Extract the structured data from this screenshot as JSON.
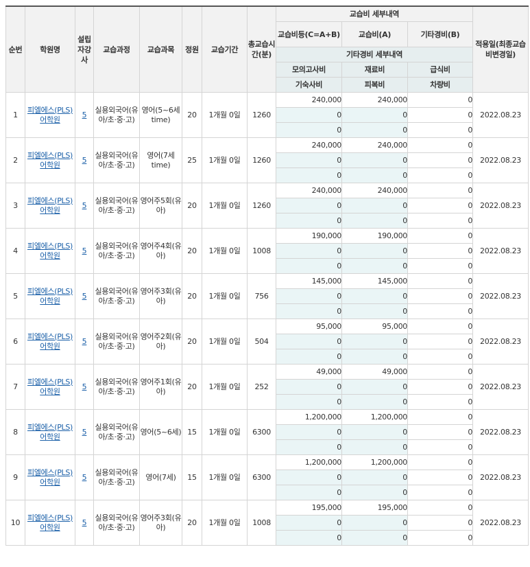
{
  "header": {
    "seq": "순번",
    "academy": "학원명",
    "founder": "설립자강사",
    "course": "교습과정",
    "subject": "교습과목",
    "capacity": "정원",
    "period": "교습기간",
    "total_time": "총교습시간(분)",
    "fee_detail": "교습비 세부내역",
    "fee_total": "교습비등(C=A+B)",
    "fee_a": "교습비(A)",
    "fee_b": "기타경비(B)",
    "apply_date": "적용일(최종교습비변경일)",
    "other_detail": "기타경비 세부내역",
    "mock_exam": "모의고사비",
    "material": "재료비",
    "meal": "급식비",
    "dorm": "기숙사비",
    "uniform": "피복비",
    "vehicle": "차량비"
  },
  "rows": [
    {
      "no": "1",
      "name": "피엘에스(PLS)어학원",
      "teacher": "5",
      "course": "실용외국어(유아/초·중·고)",
      "subject": "영어(5~6세time)",
      "cap": "20",
      "period": "1개월 0일",
      "time": "1260",
      "total": "240,000",
      "a": "240,000",
      "b": "0",
      "m1": "0",
      "m2": "0",
      "m3": "0",
      "d1": "0",
      "d2": "0",
      "d3": "0",
      "date": "2022.08.23"
    },
    {
      "no": "2",
      "name": "피엘에스(PLS)어학원",
      "teacher": "5",
      "course": "실용외국어(유아/초·중·고)",
      "subject": "영어(7세time)",
      "cap": "25",
      "period": "1개월 0일",
      "time": "1260",
      "total": "240,000",
      "a": "240,000",
      "b": "0",
      "m1": "0",
      "m2": "0",
      "m3": "0",
      "d1": "0",
      "d2": "0",
      "d3": "0",
      "date": "2022.08.23"
    },
    {
      "no": "3",
      "name": "피엘에스(PLS)어학원",
      "teacher": "5",
      "course": "실용외국어(유아/초·중·고)",
      "subject": "영어주5회(유아)",
      "cap": "20",
      "period": "1개월 0일",
      "time": "1260",
      "total": "240,000",
      "a": "240,000",
      "b": "0",
      "m1": "0",
      "m2": "0",
      "m3": "0",
      "d1": "0",
      "d2": "0",
      "d3": "0",
      "date": "2022.08.23"
    },
    {
      "no": "4",
      "name": "피엘에스(PLS)어학원",
      "teacher": "5",
      "course": "실용외국어(유아/초·중·고)",
      "subject": "영어주4회(유아)",
      "cap": "20",
      "period": "1개월 0일",
      "time": "1008",
      "total": "190,000",
      "a": "190,000",
      "b": "0",
      "m1": "0",
      "m2": "0",
      "m3": "0",
      "d1": "0",
      "d2": "0",
      "d3": "0",
      "date": "2022.08.23"
    },
    {
      "no": "5",
      "name": "피엘에스(PLS)어학원",
      "teacher": "5",
      "course": "실용외국어(유아/초·중·고)",
      "subject": "영어주3회(유아)",
      "cap": "20",
      "period": "1개월 0일",
      "time": "756",
      "total": "145,000",
      "a": "145,000",
      "b": "0",
      "m1": "0",
      "m2": "0",
      "m3": "0",
      "d1": "0",
      "d2": "0",
      "d3": "0",
      "date": "2022.08.23"
    },
    {
      "no": "6",
      "name": "피엘에스(PLS)어학원",
      "teacher": "5",
      "course": "실용외국어(유아/초·중·고)",
      "subject": "영어주2회(유아)",
      "cap": "20",
      "period": "1개월 0일",
      "time": "504",
      "total": "95,000",
      "a": "95,000",
      "b": "0",
      "m1": "0",
      "m2": "0",
      "m3": "0",
      "d1": "0",
      "d2": "0",
      "d3": "0",
      "date": "2022.08.23"
    },
    {
      "no": "7",
      "name": "피엘에스(PLS)어학원",
      "teacher": "5",
      "course": "실용외국어(유아/초·중·고)",
      "subject": "영어주1회(유아)",
      "cap": "20",
      "period": "1개월 0일",
      "time": "252",
      "total": "49,000",
      "a": "49,000",
      "b": "0",
      "m1": "0",
      "m2": "0",
      "m3": "0",
      "d1": "0",
      "d2": "0",
      "d3": "0",
      "date": "2022.08.23"
    },
    {
      "no": "8",
      "name": "피엘에스(PLS)어학원",
      "teacher": "5",
      "course": "실용외국어(유아/초·중·고)",
      "subject": "영어(5~6세)",
      "cap": "15",
      "period": "1개월 0일",
      "time": "6300",
      "total": "1,200,000",
      "a": "1,200,000",
      "b": "0",
      "m1": "0",
      "m2": "0",
      "m3": "0",
      "d1": "0",
      "d2": "0",
      "d3": "0",
      "date": "2022.08.23"
    },
    {
      "no": "9",
      "name": "피엘에스(PLS)어학원",
      "teacher": "5",
      "course": "실용외국어(유아/초·중·고)",
      "subject": "영어(7세)",
      "cap": "15",
      "period": "1개월 0일",
      "time": "6300",
      "total": "1,200,000",
      "a": "1,200,000",
      "b": "0",
      "m1": "0",
      "m2": "0",
      "m3": "0",
      "d1": "0",
      "d2": "0",
      "d3": "0",
      "date": "2022.08.23"
    },
    {
      "no": "10",
      "name": "피엘에스(PLS)어학원",
      "teacher": "5",
      "course": "실용외국어(유아/초·중·고)",
      "subject": "영어주3회(유아)",
      "cap": "20",
      "period": "1개월 0일",
      "time": "1008",
      "total": "195,000",
      "a": "195,000",
      "b": "0",
      "m1": "0",
      "m2": "0",
      "m3": "0",
      "d1": "0",
      "d2": "0",
      "d3": "0",
      "date": "2022.08.23"
    }
  ]
}
